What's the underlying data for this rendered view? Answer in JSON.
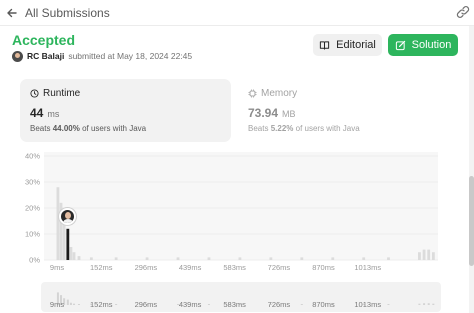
{
  "nav": {
    "back_label": "All Submissions"
  },
  "submission": {
    "status": "Accepted",
    "user": "RC Balaji",
    "submitted_text": "submitted at May 18, 2024 22:45"
  },
  "actions": {
    "editorial_label": "Editorial",
    "solution_label": "Solution"
  },
  "runtime": {
    "label": "Runtime",
    "value": "44",
    "unit": "ms",
    "beats_prefix": "Beats",
    "beats_value": "44.00%",
    "beats_suffix": "of users with Java"
  },
  "memory": {
    "label": "Memory",
    "value": "73.94",
    "unit": "MB",
    "beats_prefix": "Beats",
    "beats_value": "5.22%",
    "beats_suffix": "of users with Java"
  },
  "colors": {
    "accent": "#2db55d",
    "selected_bar": "#1a1a1a",
    "bar": "#dcdcdc"
  },
  "icons": {
    "back": "arrow-left-icon",
    "share": "link-icon",
    "editorial": "book-icon",
    "solution": "edit-icon",
    "runtime": "clock-icon",
    "memory": "chip-icon"
  },
  "chart_data": {
    "type": "bar",
    "title": "",
    "xlabel": "",
    "ylabel": "",
    "y_ticks": [
      "40%",
      "30%",
      "20%",
      "10%",
      "0%"
    ],
    "ylim": [
      0,
      40
    ],
    "x_ticks": [
      "9ms",
      "152ms",
      "296ms",
      "439ms",
      "583ms",
      "726ms",
      "870ms",
      "1013ms"
    ],
    "x_tick_values": [
      9,
      152,
      296,
      439,
      583,
      726,
      870,
      1013
    ],
    "xlim": [
      9,
      1240
    ],
    "grid": true,
    "selected_x": 44,
    "series": [
      {
        "x": [
          12,
          22,
          32,
          44,
          54,
          64,
          80,
          120,
          200,
          300,
          400,
          500,
          600,
          700,
          800,
          900,
          1000,
          1080,
          1180,
          1195,
          1210,
          1225
        ],
        "values": [
          28,
          22,
          15,
          12,
          5,
          3,
          1.5,
          1,
          1,
          1,
          1,
          1,
          1,
          1,
          1,
          1,
          1,
          1,
          3,
          4,
          4,
          3
        ]
      }
    ]
  },
  "range_data": {
    "x_ticks": [
      "9ms",
      "152ms",
      "296ms",
      "439ms",
      "583ms",
      "726ms",
      "870ms",
      "1013ms"
    ]
  }
}
